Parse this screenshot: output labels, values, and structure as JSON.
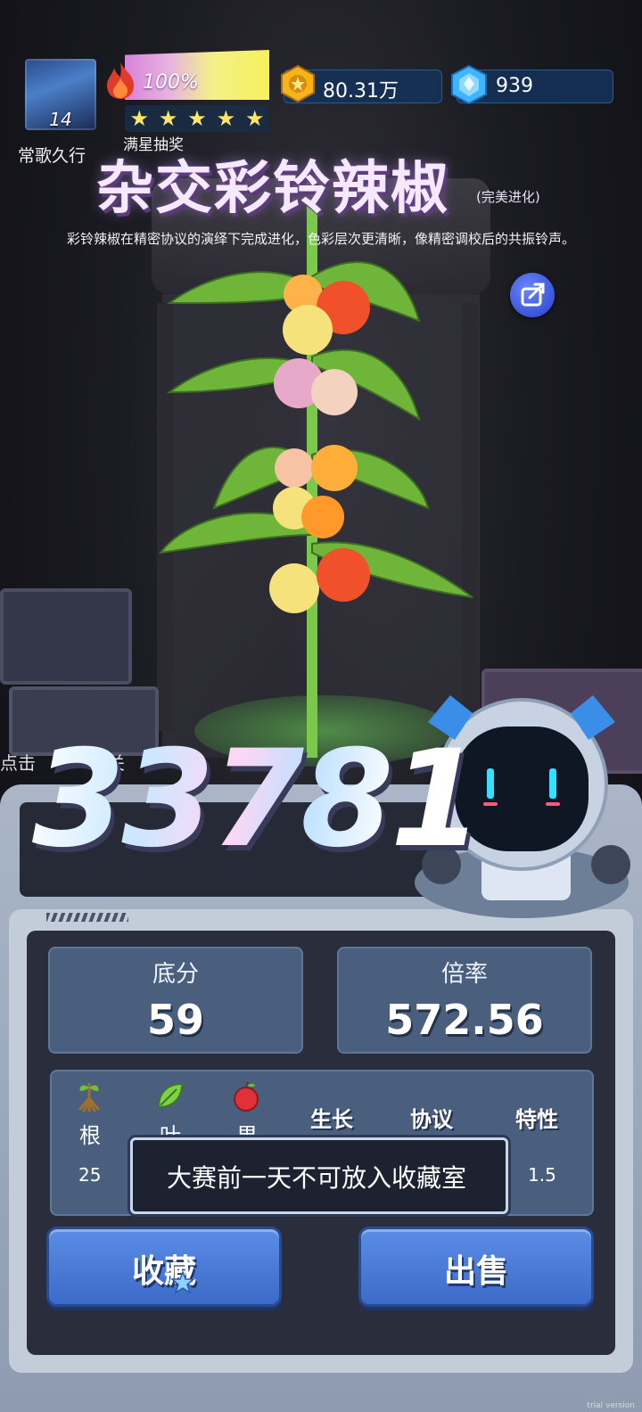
{
  "hud": {
    "level": "14",
    "player_name": "常歌久行",
    "heat_percent": "100%",
    "stars": [
      "★",
      "★",
      "★",
      "★",
      "★"
    ],
    "stars_label": "满星抽奖",
    "coins": "80.31万",
    "gems": "939"
  },
  "plant": {
    "title": "杂交彩铃辣椒",
    "title_suffix": "(完美进化)",
    "description": "彩铃辣椒在精密协议的演绎下完成进化，色彩层次更清晰，像精密调校后的共振铃声。"
  },
  "scene": {
    "hint_text": "点击",
    "hint_text_tail": "关"
  },
  "score": "33781",
  "stats": {
    "base_label": "底分",
    "base_value": "59",
    "mult_label": "倍率",
    "mult_value": "572.56"
  },
  "attributes": {
    "root_label": "根",
    "leaf_label": "叶",
    "fruit_label": "果",
    "growth_head": "生长",
    "protocol_head": "协议",
    "trait_head": "特性",
    "root_value": "25",
    "trait_value": "1.5"
  },
  "notice": "大赛前一天不可放入收藏室",
  "buttons": {
    "collect": "收藏",
    "sell": "出售"
  },
  "watermark": "trial version",
  "colors": {
    "panel_blue": "#4a5f7e",
    "button_blue": "#3c6ac8",
    "star_yellow": "#ffe46a"
  }
}
